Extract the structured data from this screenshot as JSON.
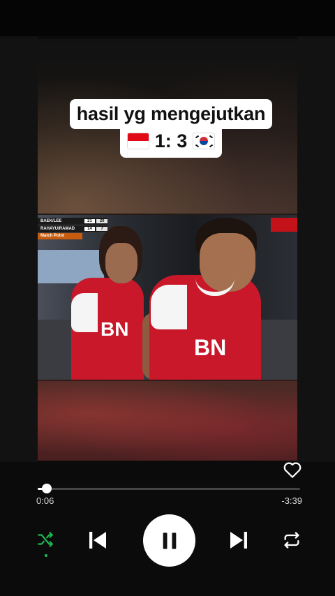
{
  "post": {
    "caption_line1": "hasil yg mengejutkan",
    "caption_score": "1: 3",
    "flag_left": "indonesia-flag",
    "flag_right": "south-korea-flag"
  },
  "video": {
    "score_rows": [
      {
        "name": "BAEK/LEE",
        "game1": "21",
        "game2": "20"
      },
      {
        "name": "RAHAYU/RAMAD",
        "game1": "14",
        "game2": "7"
      }
    ],
    "match_point_label": "Match Point",
    "jersey_text": "BN"
  },
  "player": {
    "elapsed": "0:06",
    "remaining": "-3:39",
    "progress": 0.035,
    "like_icon": "heart-outline-icon",
    "controls": [
      "shuffle-icon",
      "skip-previous-icon",
      "pause-icon",
      "skip-next-icon",
      "repeat-icon"
    ],
    "accent_color": "#1db954"
  }
}
